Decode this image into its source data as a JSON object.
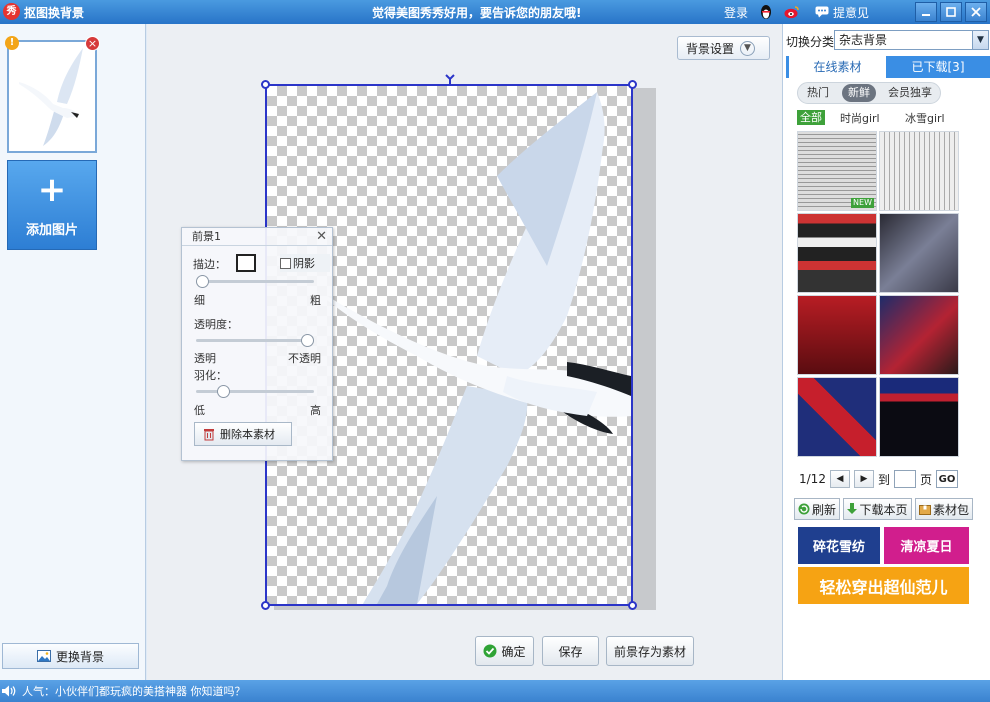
{
  "titlebar": {
    "app_icon_text": "秀",
    "app_title": "抠图换背景",
    "center_message": "觉得美图秀秀好用，要告诉您的朋友哦!",
    "login": "登录",
    "feedback": "提意见",
    "qq_icon": "qq-penguin-icon",
    "weibo_icon": "weibo-icon"
  },
  "left": {
    "thumbnail_warning": "!",
    "thumbnail_close": "×",
    "add_plus": "+",
    "add_image_label": "添加图片",
    "change_background_label": "更换背景"
  },
  "center": {
    "background_settings": "背景设置",
    "foreground_panel": {
      "title": "前景1",
      "stroke_label": "描边：",
      "shadow_label": "阴影",
      "shadow_checked": false,
      "thin_label": "细",
      "thick_label": "粗",
      "stroke_level": 0.0,
      "opacity_label": "透明度：",
      "transparent_label": "透明",
      "opaque_label": "不透明",
      "opacity_level": 1.0,
      "feather_label": "羽化：",
      "low_label": "低",
      "high_label": "高",
      "feather_level": 0.2,
      "delete_label": "删除本素材"
    },
    "ok_label": "确定",
    "save_label": "保存",
    "save_as_material_label": "前景存为素材"
  },
  "right": {
    "category_label": "切换分类",
    "category_value": "杂志背景",
    "tabs": [
      {
        "label": "在线素材",
        "active": true
      },
      {
        "label": "已下载[3]",
        "active": false
      }
    ],
    "sub_tabs": [
      {
        "label": "热门",
        "active": false
      },
      {
        "label": "新鲜",
        "active": true
      },
      {
        "label": "会员独享",
        "active": false
      }
    ],
    "filters": [
      {
        "label": "全部",
        "active": true
      },
      {
        "label": "时尚girl",
        "active": false
      },
      {
        "label": "冰雪girl",
        "active": false
      }
    ],
    "new_badge": "NEW",
    "pager": {
      "page_info": "1/12",
      "goto_label": "到",
      "page_unit": "页",
      "go_label": "GO"
    },
    "refresh_label": "刷新",
    "download_page_label": "下载本页",
    "material_pack_label": "素材包",
    "banners": {
      "b1": "碎花雪纺",
      "b2": "清凉夏日",
      "b3": "轻松穿出超仙范儿"
    },
    "colors": {
      "banner1": "#1f3f8f",
      "banner2": "#d11e8d",
      "banner3": "#f6a313"
    }
  },
  "status": {
    "text": "人气：小伙伴们都玩疯的美搭神器 你知道吗？"
  }
}
